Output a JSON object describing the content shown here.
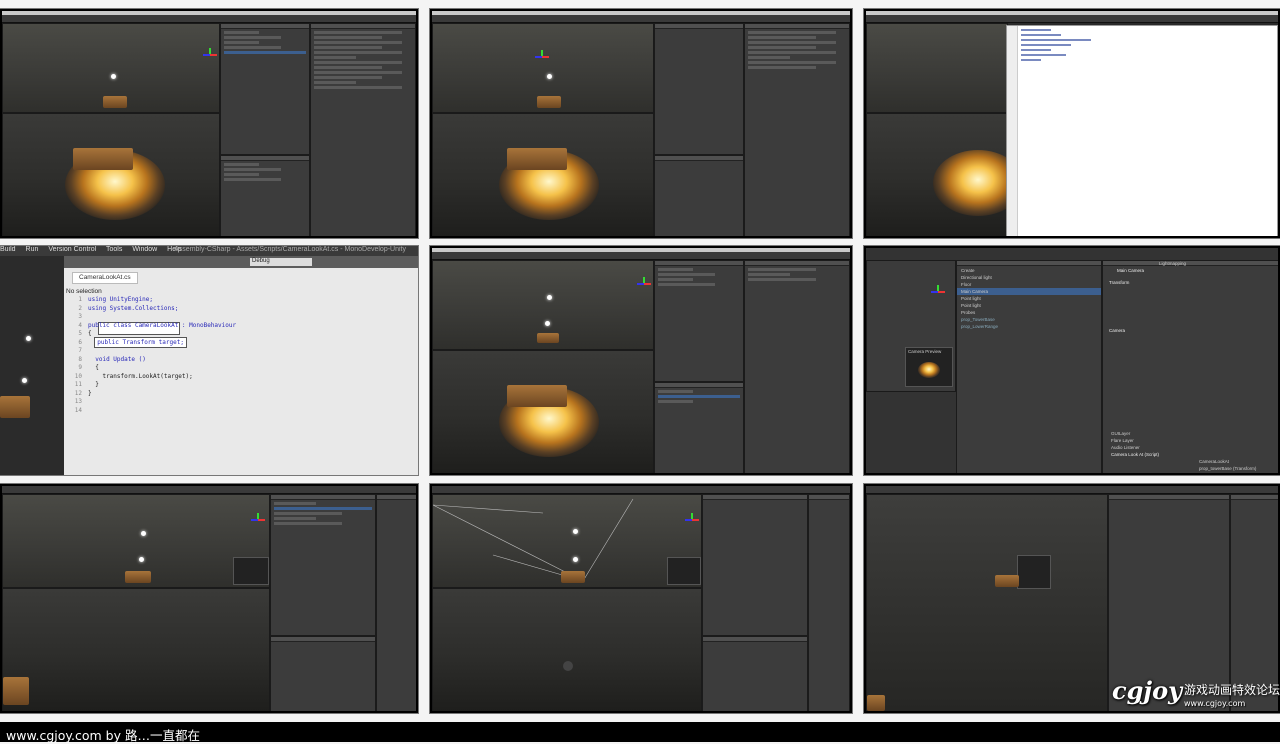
{
  "thumbnails": [
    {
      "id": 1,
      "kind": "unity-editor"
    },
    {
      "id": 2,
      "kind": "unity-editor"
    },
    {
      "id": 3,
      "kind": "unity-editor-with-script"
    },
    {
      "id": 4,
      "kind": "monodevelop"
    },
    {
      "id": 5,
      "kind": "unity-editor"
    },
    {
      "id": 6,
      "kind": "unity-inspector-camera"
    },
    {
      "id": 7,
      "kind": "unity-editor-camera-preview"
    },
    {
      "id": 8,
      "kind": "unity-editor-camera-preview"
    },
    {
      "id": 9,
      "kind": "unity-editor"
    }
  ],
  "monodevelop": {
    "menu": [
      "Build",
      "Run",
      "Version Control",
      "Tools",
      "Window",
      "Help"
    ],
    "title_path": "Assembly-CSharp - Assets/Scripts/CameraLookAt.cs - MonoDevelop-Unity",
    "config": "Debug",
    "tab": "CameraLookAt.cs",
    "no_selection": "No selection",
    "line_numbers": "1\n2\n3\n4\n5\n6\n7\n8\n9\n10\n11\n12\n13\n14",
    "code_line_1": "using UnityEngine;",
    "code_line_2": "using System.Collections;",
    "code_line_4": "public class CameraLookAt : MonoBehaviour",
    "code_line_5": "{",
    "code_line_6": "public Transform target;",
    "code_line_8": "void Update ()",
    "code_line_9": "{",
    "code_line_10": "transform.LookAt(target);",
    "code_line_11": "}",
    "code_line_12": "}"
  },
  "inspector": {
    "object": "Main Camera",
    "tab": "Lightmapping",
    "hierarchy": [
      "Create",
      "Directional light",
      "Floor",
      "Main Camera",
      "Point light",
      "Point light",
      "Probes",
      "prop_TowerBase",
      "prop_LowerRange"
    ],
    "components": [
      "Transform",
      "Camera",
      "GUILayer",
      "Flare Layer",
      "Audio Listener",
      "Camera Look At (Script)"
    ],
    "script_field": "CameraLookAt",
    "target_field": "prop_towerBase (Transform)",
    "preview_label": "Camera Preview"
  },
  "footer": {
    "text": "www.cgjoy.com by 路…一直都在"
  },
  "logo": {
    "brand": "cgjoy",
    "tagline": "游戏动画特效论坛",
    "url": "www.cgjoy.com"
  }
}
